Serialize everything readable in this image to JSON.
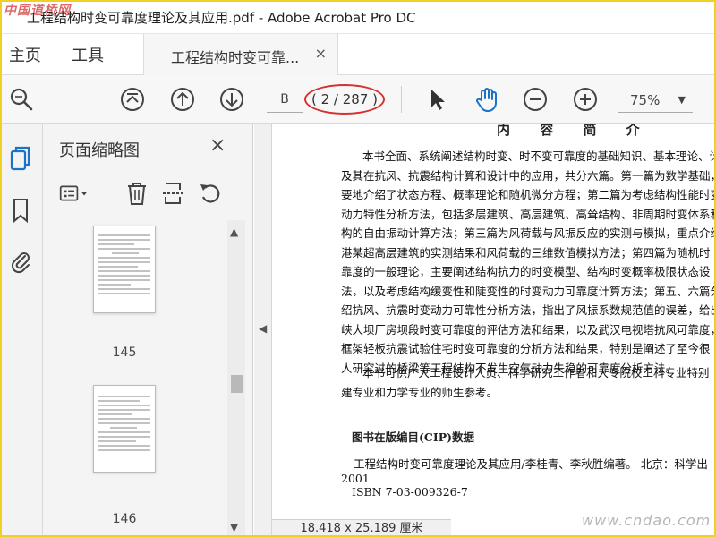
{
  "window": {
    "watermark_top": "中国道桥网",
    "title": "工程结构时变可靠度理论及其应用.pdf - Adobe Acrobat Pro DC"
  },
  "nav_tabs": {
    "home": "主页",
    "tools": "工具"
  },
  "doc_tab": {
    "label": "工程结构时变可靠...",
    "close": "×"
  },
  "toolbar": {
    "page_input_value": "B",
    "page_count": "( 2 / 287 )",
    "zoom_value": "75%"
  },
  "sidebar": {
    "panel_title": "页面缩略图",
    "close": "×",
    "thumbnails": [
      {
        "label": "145"
      },
      {
        "label": "146"
      }
    ]
  },
  "document": {
    "heading": "内 容 简 介",
    "paragraph1": [
      "本书全面、系统阐述结构时变、时不变可靠度的基础知识、基本理论、计算",
      "及其在抗风、抗震结构计算和设计中的应用，共分六篇。第一篇为数学基础，简",
      "要地介绍了状态方程、概率理论和随机微分方程；第二篇为考虑结构性能时变",
      "动力特性分析方法，包括多层建筑、高层建筑、高耸结构、非周期时变体系和弃",
      "构的自由振动计算方法；第三篇为风荷载与风振反应的实测与模拟，重点介绍",
      "港某超高层建筑的实测结果和风荷载的三维数值模拟方法；第四篇为随机时",
      "靠度的一般理论，主要阐述结构抗力的时变模型、结构时变概率极限状态设",
      "法，以及考虑结构缓变性和陡变性的时变动力可靠度计算方法；第五、六篇分",
      "绍抗风、抗震时变动力可靠性分析方法，指出了风振系数规范值的误差，给出",
      "峡大坝厂房坝段时变可靠度的评估方法和结果，以及武汉电视塔抗风可靠度，",
      "框架轻板抗震试验住宅时变可靠度的分析方法和结果，特别是阐述了至今很",
      "人研究过的桥梁等工程结构不发生空气动力失稳的可靠度分析方法。"
    ],
    "paragraph2": [
      "本书可供广大工程设计人员、科学研究工作者和大专院校工科专业特别",
      "建专业和力学专业的师生参考。"
    ],
    "cip_heading": "图书在版编目(CIP)数据",
    "cip_line1": "工程结构时变可靠度理论及其应用/李桂青、李秋胜编著。-北京：科学出",
    "cip_line2": "2001",
    "cip_line3": "ISBN 7-03-009326-7"
  },
  "status": {
    "page_size": "18.418 x 25.189 厘米",
    "watermark_bottom": "www.cndao.com"
  },
  "colors": {
    "highlight_circle": "#d63030",
    "frame": "#f0d020",
    "hand_tool": "#1a73c8",
    "rail_active": "#1a73c8"
  }
}
